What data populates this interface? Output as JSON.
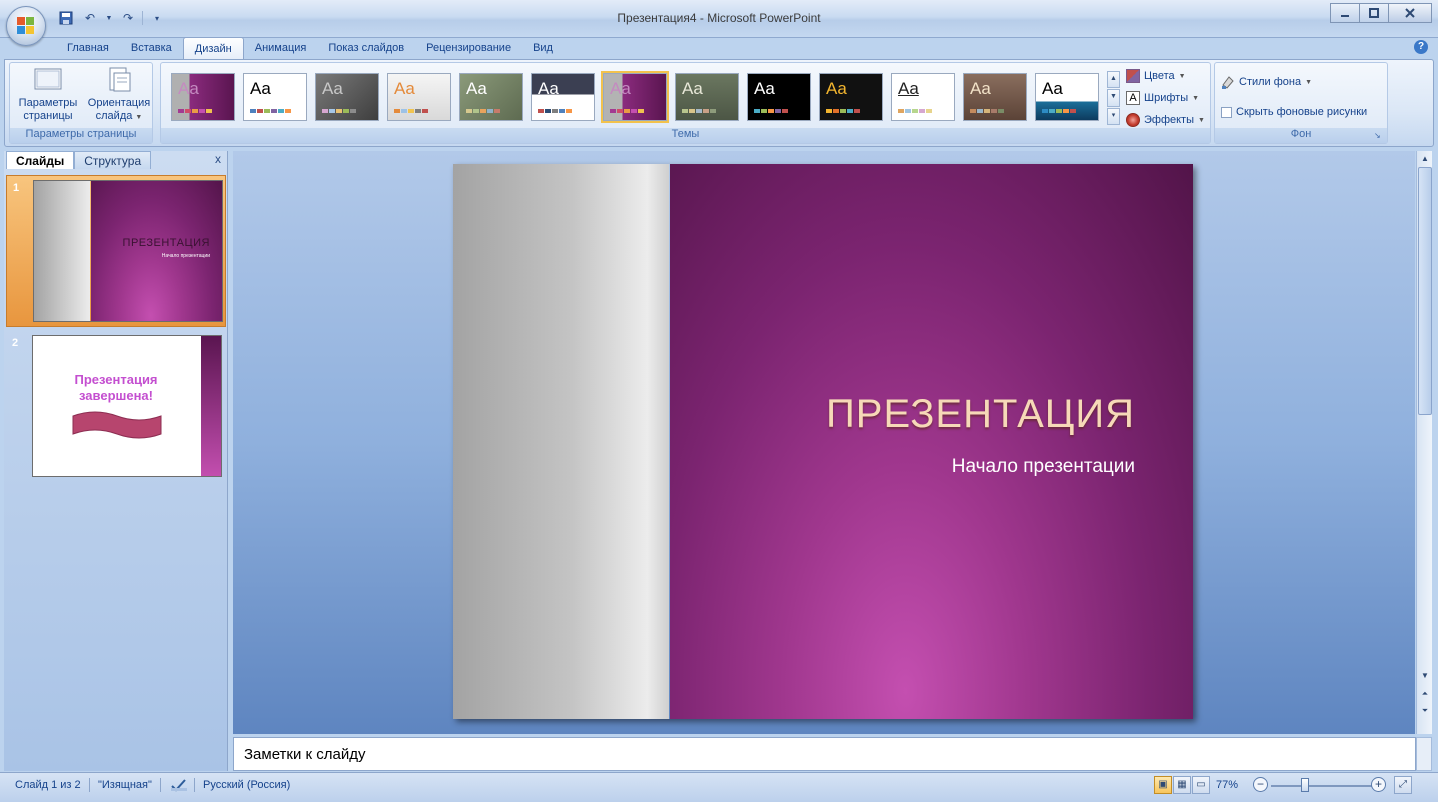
{
  "window": {
    "title": "Презентация4 - Microsoft PowerPoint",
    "minimize": "▁",
    "maximize": "□",
    "close": "✕"
  },
  "ribbon_tabs": [
    "Главная",
    "Вставка",
    "Дизайн",
    "Анимация",
    "Показ слайдов",
    "Рецензирование",
    "Вид"
  ],
  "active_tab": "Дизайн",
  "groups": {
    "page_setup": {
      "label": "Параметры страницы",
      "page_params_line1": "Параметры",
      "page_params_line2": "страницы",
      "orientation_line1": "Ориентация",
      "orientation_line2": "слайда"
    },
    "themes": {
      "label": "Темы",
      "sample_text": "Aa",
      "colors": "Цвета",
      "fonts": "Шрифты",
      "effects": "Эффекты"
    },
    "background": {
      "label": "Фон",
      "styles": "Стили фона",
      "hide_graphics": "Скрыть фоновые рисунки"
    }
  },
  "left_pane": {
    "tab_slides": "Слайды",
    "tab_outline": "Структура",
    "close": "x",
    "thumbnails": [
      {
        "number": "1",
        "title": "ПРЕЗЕНТАЦИЯ",
        "subtitle": "Начало презентации"
      },
      {
        "number": "2",
        "title_line1": "Презентация",
        "title_line2": "завершена!"
      }
    ]
  },
  "slide": {
    "title": "ПРЕЗЕНТАЦИЯ",
    "subtitle": "Начало презентации"
  },
  "notes": {
    "placeholder": "Заметки к слайду"
  },
  "status": {
    "slide_info": "Слайд 1 из 2",
    "theme_name": "\"Изящная\"",
    "language": "Русский (Россия)",
    "zoom": "77%",
    "zoom_value": 77
  }
}
